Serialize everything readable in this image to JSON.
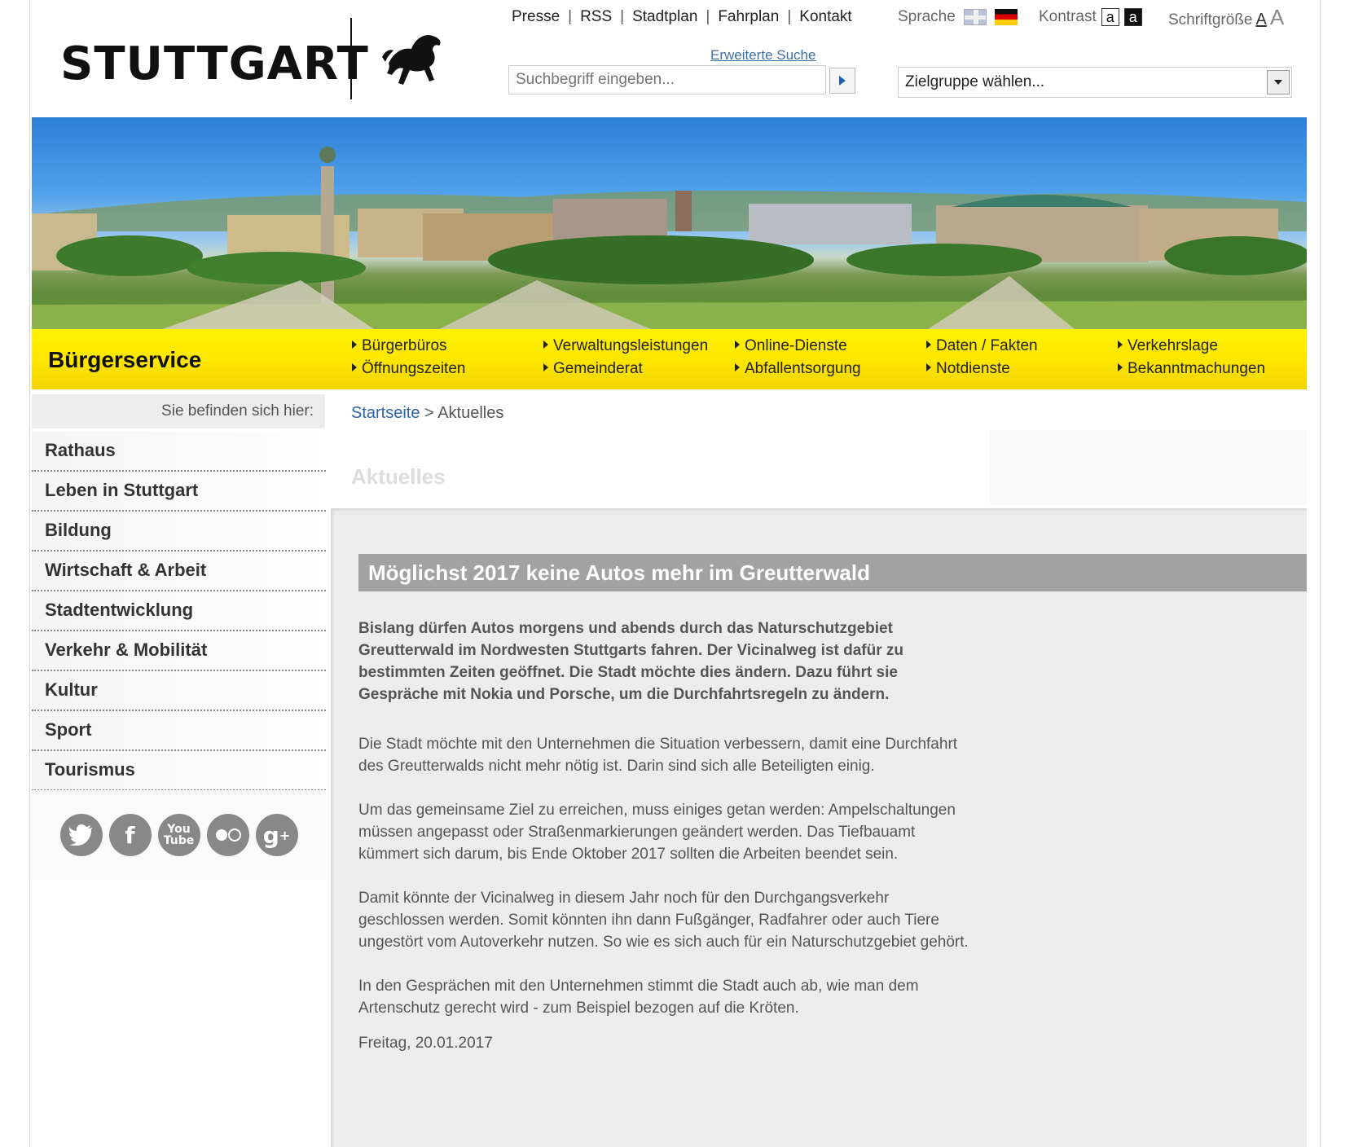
{
  "header": {
    "logo_text": "STUTTGART",
    "top_links": [
      "Presse",
      "RSS",
      "Stadtplan",
      "Fahrplan",
      "Kontakt"
    ],
    "language_label": "Sprache",
    "contrast_label": "Kontrast",
    "contrast_light": "a",
    "contrast_dark": "a",
    "fontsize_label": "Schriftgröße",
    "fontsize_small": "A",
    "fontsize_large": "A",
    "advanced_search": "Erweiterte Suche",
    "search_placeholder": "Suchbegriff eingeben...",
    "target_group": "Zielgruppe wählen..."
  },
  "service_bar": {
    "title": "Bürgerservice",
    "links": [
      [
        "Bürgerbüros",
        "Öffnungszeiten"
      ],
      [
        "Verwaltungsleistungen",
        "Gemeinderat"
      ],
      [
        "Online-Dienste",
        "Abfallentsorgung"
      ],
      [
        "Daten / Fakten",
        "Notdienste"
      ],
      [
        "Verkehrslage",
        "Bekanntmachungen"
      ]
    ]
  },
  "sidebar": {
    "here_label": "Sie befinden sich hier:",
    "items": [
      "Rathaus",
      "Leben in Stuttgart",
      "Bildung",
      "Wirtschaft & Arbeit",
      "Stadtentwicklung",
      "Verkehr & Mobilität",
      "Kultur",
      "Sport",
      "Tourismus"
    ],
    "social": [
      "twitter-icon",
      "facebook-icon",
      "youtube-icon",
      "flickr-icon",
      "googleplus-icon"
    ]
  },
  "breadcrumb": {
    "home": "Startseite",
    "separator": ">",
    "current": "Aktuelles"
  },
  "main": {
    "page_heading": "Aktuelles",
    "article_title": "Möglichst 2017 keine Autos mehr im Greutterwald",
    "lead": "Bislang dürfen Autos morgens und abends durch das Naturschutzgebiet Greutterwald im Nordwesten Stuttgarts fahren. Der Vicinalweg ist dafür zu bestimmten Zeiten geöffnet. Die Stadt möchte dies ändern. Dazu führt sie Gespräche mit Nokia und Porsche, um die Durchfahrtsregeln zu ändern.",
    "paragraphs": [
      "Die Stadt möchte mit den Unternehmen die Situation verbessern, damit eine Durchfahrt des Greutterwalds nicht mehr nötig ist. Darin sind sich alle Beteiligten einig.",
      "Um das gemeinsame Ziel zu erreichen, muss einiges getan werden: Ampelschaltungen müssen angepasst oder Straßenmarkierungen geändert werden. Das Tiefbauamt kümmert sich darum, bis Ende Oktober 2017 sollten die Arbeiten beendet sein.",
      "Damit könnte der Vicinalweg in diesem Jahr noch für den Durchgangsverkehr geschlossen werden. Somit könnten ihn dann Fußgänger, Radfahrer oder auch Tiere ungestört vom Autoverkehr nutzen. So wie es sich auch für ein Naturschutzgebiet gehört.",
      "In den Gesprächen mit den Unternehmen stimmt die Stadt auch ab, wie man dem Artenschutz gerecht wird - zum Beispiel bezogen auf die Kröten."
    ],
    "date": "Freitag, 20.01.2017"
  }
}
